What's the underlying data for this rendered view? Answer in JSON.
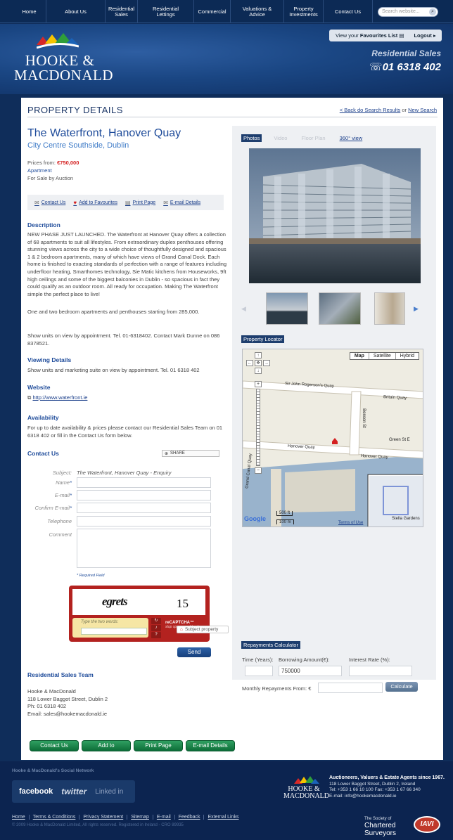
{
  "nav": {
    "items": [
      "Home",
      "About Us",
      "Residential Sales",
      "Residential Lettings",
      "Commercial",
      "Valuations & Advice",
      "Property Investments",
      "Contact Us"
    ],
    "search_placeholder": "Search website..."
  },
  "header": {
    "logo": "HOOKE & MACDONALD",
    "favourites_prefix": "View your",
    "favourites_link": "Favourites List",
    "logout": "Logout",
    "department": "Residential Sales",
    "phone": "01 6318 402"
  },
  "page": {
    "title": "PROPERTY DETAILS",
    "back_link": "< Back do Search Results",
    "or": "or",
    "new_search": "New Search"
  },
  "property": {
    "title": "The Waterfront, Hanover Quay",
    "location": "City Centre Southside, Dublin",
    "price_label": "Prices from:",
    "price_value": "€750,000",
    "type": "Apartment",
    "sale_type": "For Sale by Auction"
  },
  "actions": {
    "contact": "Contact Us",
    "favourites": "Add to Favourites",
    "print": "Print Page",
    "email": "E-mail Details"
  },
  "description": {
    "heading": "Description",
    "body": "NEW PHASE JUST LAUNCHED. The Waterfront at Hanover Quay offers a collection of 68 apartments to suit all lifestyles. From extraordinary duplex penthouses offering stunning views across the city to a wide choice of thoughtfully designed and spacious 1 & 2 bedroom apartments, many of which have views of Grand Canal Dock. Each home is finished to exacting standards of perfection with a range of features including underfloor heating, Smarthomes technology, Sie Matic kitchens from Houseworks, 9ft high ceilings and some of the biggest balconies in Dublin - so spacious in fact they could qualify as an outdoor room. All ready for occupation. Making The Waterfront simple the perfect place to live!",
    "body2": "One and two bedroom apartments and penthouses starting from 285,000.",
    "body3": "Show units on view by appointment. Tel. 01-6318402. Contact Mark Dunne on 086 8378521."
  },
  "viewing": {
    "heading": "Viewing Details",
    "body": "Show units and marketing suite on view by appointment. Tel. 01 6318 402"
  },
  "website": {
    "heading": "Website",
    "url": "http://www.waterfront.ie"
  },
  "availability": {
    "heading": "Availability",
    "body": "For up to date availability & prices please contact our Residential Sales Team on 01 6318 402 or fill in the Contact Us form below."
  },
  "contact_form": {
    "heading": "Contact Us",
    "share": "SHARE",
    "subject_label": "Subject:",
    "subject_value": "The Waterfront, Hanover Quay - Enquiry",
    "name_label": "Name",
    "email_label": "E-mail",
    "confirm_label": "Confirm E-mail",
    "phone_label": "Telephone",
    "comment_label": "Comment",
    "required_note": "* Required Field",
    "captcha_word1": "egrets",
    "captcha_word2": "15",
    "captcha_prompt": "Type the two words:",
    "captcha_brand": "reCAPTCHA™",
    "captcha_tagline": "stop spam. read books.",
    "send": "Send"
  },
  "team": {
    "heading": "Residential Sales Team",
    "name": "Hooke & MacDonald",
    "address": "118 Lower Baggot Street, Dublin 2",
    "phone": "Ph: 01 6318 402",
    "email": "Email: sales@hookemacdonald.ie"
  },
  "bottom_buttons": [
    "Contact Us",
    "Add to Favourites",
    "Print Page",
    "E-mail Details"
  ],
  "media": {
    "tabs": [
      "Photos",
      "Video",
      "Floor Plan",
      "360° view"
    ],
    "active_tab": "Photos"
  },
  "map": {
    "heading": "Property Locator",
    "types": [
      "Map",
      "Satellite",
      "Hybrid"
    ],
    "streets": [
      "Sir John Rogerson's Quay",
      "Britain Quay",
      "Benson St",
      "Green St E",
      "Hanover Quay",
      "Hanover Quay",
      "Grand Canal Quay",
      "Stella Gardens"
    ],
    "scale_ft": "500 ft",
    "scale_m": "100 m",
    "terms": "Terms of Use",
    "powered": "Google",
    "subject_legend": "Subject property"
  },
  "calculator": {
    "heading": "Repayments Calculator",
    "time_label": "Time (Years):",
    "amount_label": "Borrowing Amount(€):",
    "amount_value": "750000",
    "rate_label": "Interest Rate (%):",
    "monthly_label": "Monthly Repayments From: €",
    "calc_button": "Calculate"
  },
  "footer": {
    "social_title": "Hooke & MacDonald's Social Network",
    "facebook": "facebook",
    "twitter": "twitter",
    "linkedin": "Linked in",
    "logo": "HOOKE & MACDONALD",
    "tagline": "Auctioneers, Valuers & Estate Agents since 1967.",
    "address": "118 Lower Baggot Street, Dublin 2, Ireland",
    "tel": "Tel: +353 1 66 10 100 Fax: +353 1 67 66 340",
    "email": "E-mail: info@hookemacdonald.ie",
    "links": [
      "Home",
      "Terms & Conditions",
      "Privacy Statement",
      "Sitemap",
      "E-mail",
      "Feedback",
      "External Links"
    ],
    "copyright": "© 2009 Hooke & MacDonald Limited, All rights reserved. Registered in Ireland - CRO 89935",
    "chartered_top": "The Society of",
    "chartered_main": "Chartered",
    "chartered_bottom": "Surveyors",
    "iavi": "IAVI"
  }
}
